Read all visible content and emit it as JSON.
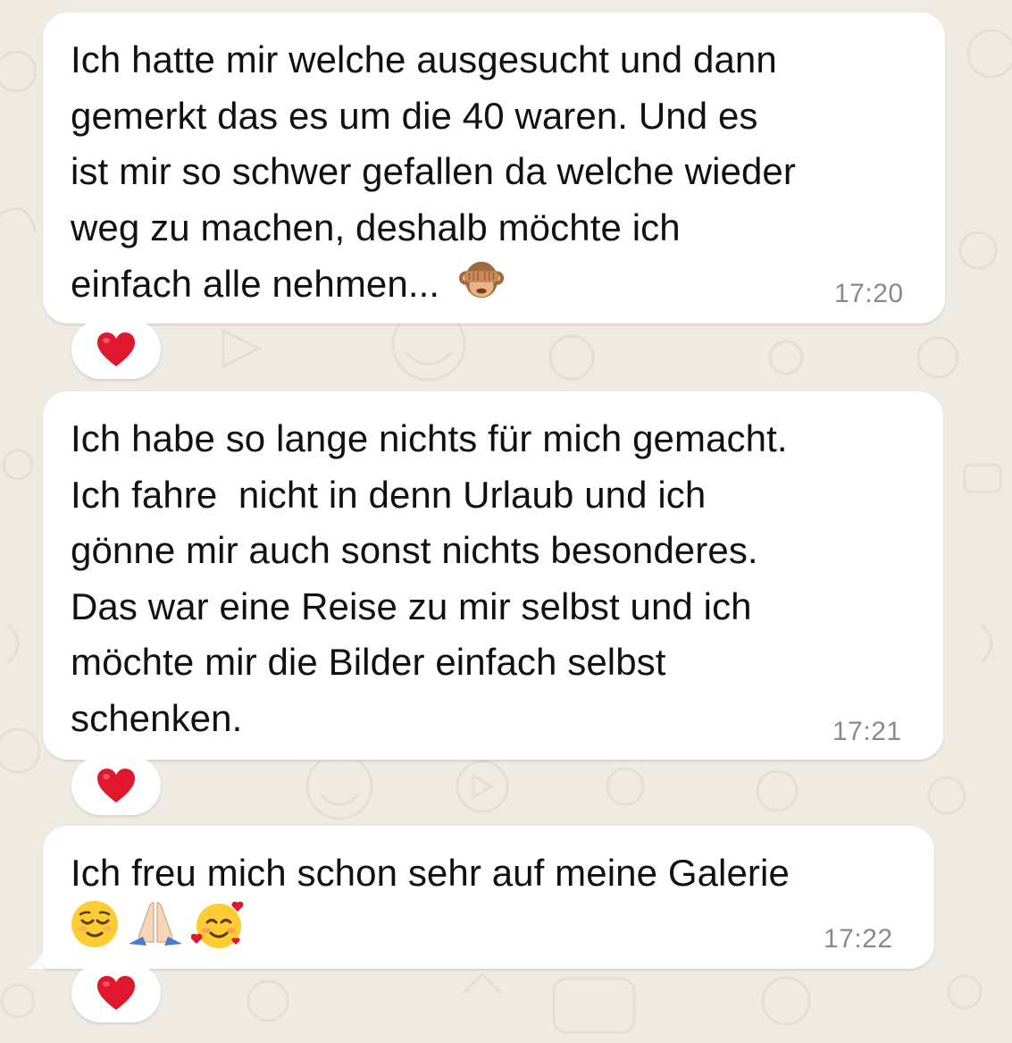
{
  "chat": {
    "messages": [
      {
        "text": "Ich hatte mir welche ausgesucht und dann\ngemerkt das es um die 40 waren. Und es\nist mir so schwer gefallen da welche wieder\nweg zu machen, deshalb möchte ich\neinfach alle nehmen... ",
        "emoji": "see-no-evil-monkey",
        "time": "17:20",
        "reaction": "❤️"
      },
      {
        "text": "Ich habe so lange nichts für mich gemacht.\nIch fahre  nicht in denn Urlaub und ich\ngönne mir auch sonst nichts besonderes.\nDas war eine Reise zu mir selbst und ich\nmöchte mir die Bilder einfach selbst\nschenken.",
        "time": "17:21",
        "reaction": "❤️"
      },
      {
        "text": "Ich freu mich schon sehr auf meine Galerie",
        "emojis": [
          "relieved-face",
          "folded-hands",
          "smiling-face-with-hearts"
        ],
        "time": "17:22",
        "reaction": "❤️"
      }
    ]
  },
  "colors": {
    "background": "#efeae2",
    "bubble": "#ffffff",
    "text": "#111111",
    "timestamp": "#8a8a8a",
    "heart": "#e0182d"
  }
}
